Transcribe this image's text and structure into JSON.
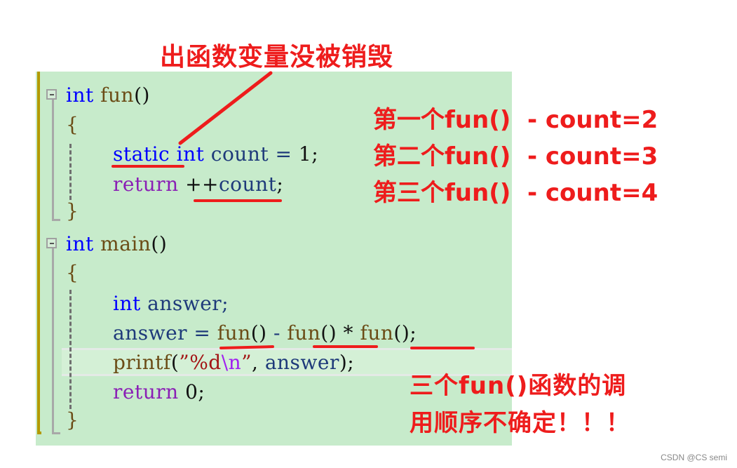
{
  "annotations": {
    "title": "出函数变量没被销毁",
    "call_notes": [
      "第一个fun()  - count=2",
      "第二个fun()  - count=3",
      "第三个fun()  - count=4"
    ],
    "order_note_line1": "三个fun()函数的调",
    "order_note_line2": "用顺序不确定！！！"
  },
  "code": {
    "lines": [
      {
        "t1": "int",
        "t2": " ",
        "t3": "fun",
        "t4": "()"
      },
      {
        "brace": "{"
      },
      {
        "kw": "static",
        "sp": " ",
        "kw2": "int",
        "rest": " count = ",
        "num": "1",
        "end": ";"
      },
      {
        "kw": "return",
        "sp": " ",
        "op": "++",
        "var": "count",
        "end": ";"
      },
      {
        "brace": "}"
      },
      {
        "t1": "int",
        "t2": " ",
        "t3": "main",
        "t4": "()"
      },
      {
        "brace": "{"
      },
      {
        "kw": "int",
        "rest": " answer;"
      },
      {
        "var": "answer",
        "eq": " = ",
        "f1": "fun",
        "p1": "()",
        "minus": " - ",
        "f2": "fun",
        "p2": "()",
        "mul": " * ",
        "f3": "fun",
        "p3": "()",
        "end": ";"
      },
      {
        "fn": "printf",
        "open": "(",
        "q1": "”",
        "fmt": "%d",
        "esc": "\\n",
        "q2": "”",
        "comma": ", ",
        "var": "answer",
        "close": ");"
      },
      {
        "kw": "return",
        "sp": " ",
        "num": "0",
        "end": ";"
      },
      {
        "brace": "}"
      }
    ]
  },
  "watermark": "CSDN @CS semi",
  "colors": {
    "editor_bg": "#c7ebcb",
    "annotation_red": "#ee1c1c",
    "keyword_blue": "#0000ff",
    "keyword_purple": "#8a1fb5",
    "function_brown": "#6b4c16"
  }
}
